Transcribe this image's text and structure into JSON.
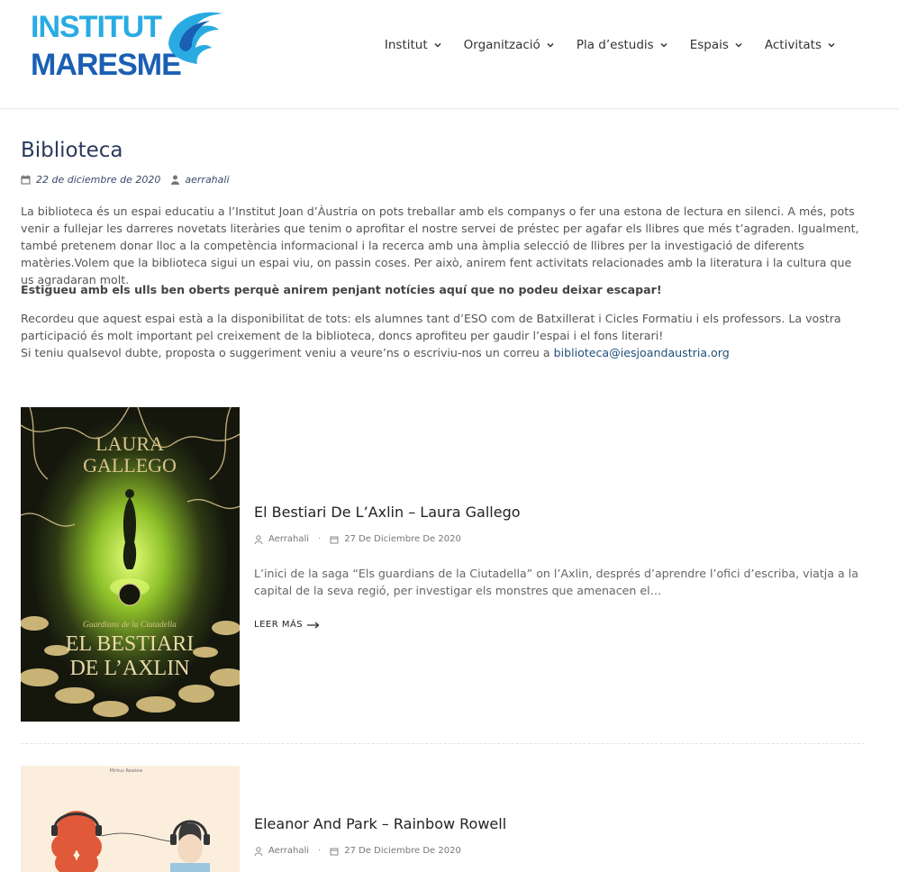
{
  "logo": {
    "line1": "INSTITUT",
    "line2": "MARESME"
  },
  "nav": {
    "items": [
      {
        "label": "Institut"
      },
      {
        "label": "Organització"
      },
      {
        "label": "Pla d’estudis"
      },
      {
        "label": "Espais"
      },
      {
        "label": "Activitats"
      }
    ]
  },
  "article": {
    "title": "Biblioteca",
    "date": "22 de diciembre de 2020",
    "author": "aerrahali",
    "paragraph1": "La biblioteca és un espai educatiu a l’Institut Joan d’Àustria on pots treballar amb els companys o fer una estona de lectura en silenci. A més, pots venir a fullejar les darreres novetats literàries que tenim o aprofitar el nostre servei de préstec per agafar els llibres que més t’agraden. Igualment, també pretenem donar lloc a la competència informacional i la recerca amb una àmplia selecció de llibres per la investigació de diferents matèries.Volem que la biblioteca sigui un espai viu, on passin coses. Per això, anirem fent activitats relacionades amb la literatura i la cultura que us agradaran molt.",
    "paragraph2": "Estigueu amb els ulls ben oberts perquè anirem penjant notícies aquí que no podeu deixar escapar!",
    "paragraph3a": "Recordeu que aquest espai està a la disponibilitat de tots: els alumnes tant d’ESO com de Batxillerat i Cicles Formatiu i els professors. La vostra participació és molt important pel creixement de la biblioteca, doncs aprofiteu per gaudir l’espai i el fons literari!",
    "paragraph3b": "Si teniu qualsevol dubte, proposta o suggeriment veniu a veure’ns o escriviu-nos un correu a ",
    "email": "biblioteca@iesjoandaustria.org"
  },
  "posts": [
    {
      "title": "El Bestiari De L’Axlin – Laura Gallego",
      "author": "Aerrahali",
      "date": "27 De Diciembre De 2020",
      "excerpt": "L’inici de la saga “Els guardians de la Ciutadella” on l’Axlin, després d’aprendre l’ofici d’escriba, viatja a la capital de la seva regió, per investigar els monstres que amenacen el…",
      "read_more": "LEER MÁS",
      "cover": {
        "author": "LAURA GALLEGO",
        "author1": "LAURA",
        "author2": "GALLEGO",
        "series": "Guardians de la Ciutadella",
        "title1": "EL BESTIARI",
        "title2": "DE L’AXLIN"
      }
    },
    {
      "title": "Eleanor And Park – Rainbow Rowell",
      "author": "Aerrahali",
      "date": "27 De Diciembre De 2020",
      "cover": {
        "top_text": "Mirkus Rewiew"
      }
    }
  ],
  "colors": {
    "accent": "#1f4f7a",
    "title": "#2a3a5a",
    "logo_light": "#29abe2",
    "logo_dark": "#1a5fb4",
    "cover1_bg": "#1a1c12",
    "cover1_glow": "#b8e04a",
    "cover1_gold": "#d8c48a",
    "cover2_bg": "#fbeedd"
  }
}
